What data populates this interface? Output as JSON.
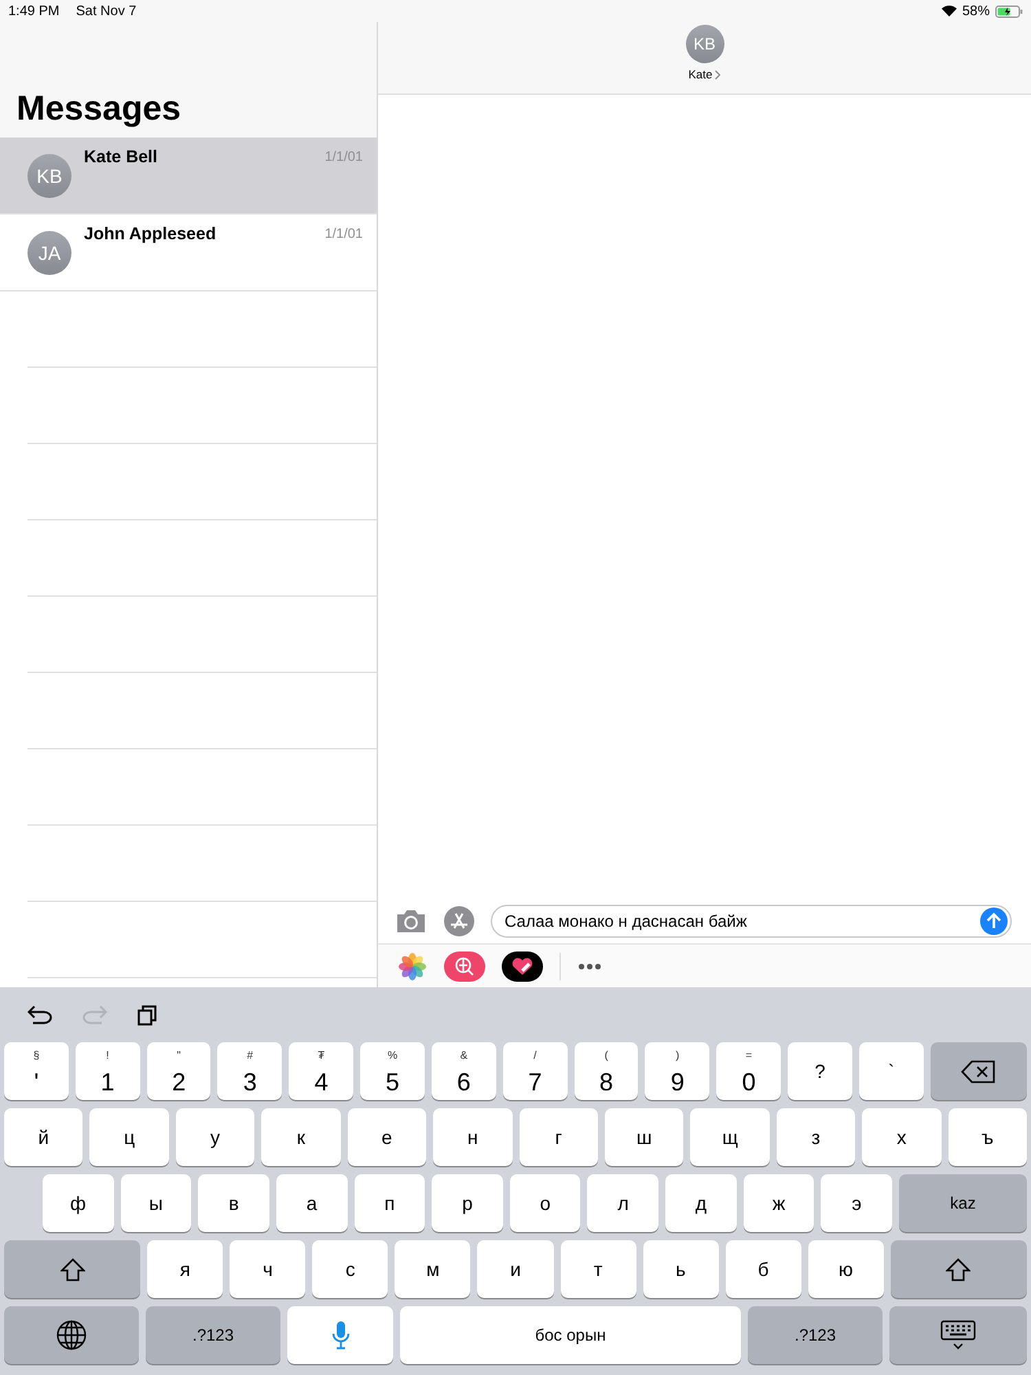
{
  "status_bar": {
    "time": "1:49 PM",
    "date": "Sat Nov 7",
    "battery": "58%"
  },
  "sidebar": {
    "title": "Messages",
    "conversations": [
      {
        "initials": "KB",
        "name": "Kate Bell",
        "date": "1/1/01",
        "selected": true
      },
      {
        "initials": "JA",
        "name": "John Appleseed",
        "date": "1/1/01",
        "selected": false
      }
    ]
  },
  "conversation": {
    "initials": "KB",
    "name": "Kate"
  },
  "composer": {
    "value": "Салаа монако н даснасан байж"
  },
  "app_strip": [
    {
      "kind": "photos"
    },
    {
      "kind": "search"
    },
    {
      "kind": "heart"
    },
    {
      "kind": "more"
    }
  ],
  "keyboard": {
    "toolbar": [
      {
        "kind": "undo",
        "disabled": false
      },
      {
        "kind": "redo",
        "disabled": true
      },
      {
        "kind": "paste",
        "disabled": false
      }
    ],
    "rows": [
      {
        "keys": [
          {
            "kind": "char",
            "label": "'",
            "sub": "§"
          },
          {
            "kind": "char",
            "label": "1",
            "sub": "!"
          },
          {
            "kind": "char",
            "label": "2",
            "sub": "\""
          },
          {
            "kind": "char",
            "label": "3",
            "sub": "#"
          },
          {
            "kind": "char",
            "label": "4",
            "sub": "₮"
          },
          {
            "kind": "char",
            "label": "5",
            "sub": "%"
          },
          {
            "kind": "char",
            "label": "6",
            "sub": "&"
          },
          {
            "kind": "char",
            "label": "7",
            "sub": "/"
          },
          {
            "kind": "char",
            "label": "8",
            "sub": "("
          },
          {
            "kind": "char",
            "label": "9",
            "sub": ")"
          },
          {
            "kind": "char",
            "label": "0",
            "sub": "="
          },
          {
            "kind": "char",
            "label": "?"
          },
          {
            "kind": "char",
            "label": "`"
          },
          {
            "kind": "delete"
          }
        ]
      },
      {
        "keys": [
          {
            "kind": "char",
            "label": "й"
          },
          {
            "kind": "char",
            "label": "ц"
          },
          {
            "kind": "char",
            "label": "у"
          },
          {
            "kind": "char",
            "label": "к"
          },
          {
            "kind": "char",
            "label": "е"
          },
          {
            "kind": "char",
            "label": "н"
          },
          {
            "kind": "char",
            "label": "г"
          },
          {
            "kind": "char",
            "label": "ш"
          },
          {
            "kind": "char",
            "label": "щ"
          },
          {
            "kind": "char",
            "label": "з"
          },
          {
            "kind": "char",
            "label": "х"
          },
          {
            "kind": "char",
            "label": "ъ"
          }
        ]
      },
      {
        "keys": [
          {
            "kind": "char",
            "label": "ф"
          },
          {
            "kind": "char",
            "label": "ы"
          },
          {
            "kind": "char",
            "label": "в"
          },
          {
            "kind": "char",
            "label": "а"
          },
          {
            "kind": "char",
            "label": "п"
          },
          {
            "kind": "char",
            "label": "р"
          },
          {
            "kind": "char",
            "label": "о"
          },
          {
            "kind": "char",
            "label": "л"
          },
          {
            "kind": "char",
            "label": "д"
          },
          {
            "kind": "char",
            "label": "ж"
          },
          {
            "kind": "char",
            "label": "э"
          },
          {
            "kind": "lang",
            "label": "kaz"
          }
        ]
      },
      {
        "keys": [
          {
            "kind": "shift"
          },
          {
            "kind": "char",
            "label": "я"
          },
          {
            "kind": "char",
            "label": "ч"
          },
          {
            "kind": "char",
            "label": "с"
          },
          {
            "kind": "char",
            "label": "м"
          },
          {
            "kind": "char",
            "label": "и"
          },
          {
            "kind": "char",
            "label": "т"
          },
          {
            "kind": "char",
            "label": "ь"
          },
          {
            "kind": "char",
            "label": "б"
          },
          {
            "kind": "char",
            "label": "ю"
          },
          {
            "kind": "shift"
          }
        ]
      },
      {
        "keys": [
          {
            "kind": "globe"
          },
          {
            "kind": "mode",
            "label": ".?123"
          },
          {
            "kind": "mic"
          },
          {
            "kind": "space",
            "label": "бос орын"
          },
          {
            "kind": "mode",
            "label": ".?123"
          },
          {
            "kind": "dismiss"
          }
        ]
      }
    ]
  }
}
